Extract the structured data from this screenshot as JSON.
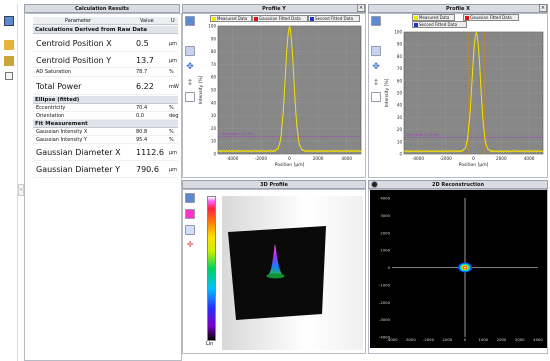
{
  "results": {
    "title": "Calculation Results",
    "col_param": "Parameter",
    "col_value": "Value",
    "col_unit": "U",
    "sections": [
      {
        "label": "Calculations Derived from Raw Data"
      },
      {
        "label": "Ellipse (fitted)"
      },
      {
        "label": "Fit Measurement"
      }
    ],
    "rows": [
      {
        "param": "Centroid Position X",
        "value": "0.5",
        "unit": "µm"
      },
      {
        "param": "Centroid Position Y",
        "value": "13.7",
        "unit": "µm"
      },
      {
        "param": "AD Saturation",
        "value": "78.7",
        "unit": "%"
      },
      {
        "param": "Total Power",
        "value": "6.22",
        "unit": "mW"
      },
      {
        "param": "Eccentricity",
        "value": "70.4",
        "unit": "%"
      },
      {
        "param": "Orientation",
        "value": "0.0",
        "unit": "deg"
      },
      {
        "param": "Gaussian Intensity X",
        "value": "80.8",
        "unit": "%"
      },
      {
        "param": "Gaussian Intensity Y",
        "value": "95.4",
        "unit": "%"
      },
      {
        "param": "Gaussian Diameter X",
        "value": "1112.6",
        "unit": "µm"
      },
      {
        "param": "Gaussian Diameter Y",
        "value": "790.6",
        "unit": "µm"
      }
    ]
  },
  "profile_y": {
    "title": "Profile Y",
    "legend": [
      "Measured Data",
      "Gaussian Fitted Data",
      "Second Fitted Data"
    ],
    "ylabel": "Intensity [%]",
    "xlabel": "Position [µm]",
    "yticks": [
      "100",
      "90",
      "80",
      "70",
      "60",
      "50",
      "40",
      "30",
      "20",
      "10",
      "0"
    ],
    "xticks": [
      "-4000",
      "-2000",
      "0",
      "2000",
      "4000"
    ],
    "clip_text": "Clip Level = 13.5%"
  },
  "profile_x": {
    "title": "Profile X",
    "legend": [
      "Measured Data",
      "Gaussian Fitted Data",
      "Second Fitted Data"
    ],
    "ylabel": "Intensity [%]",
    "xlabel": "Position [µm]",
    "yticks": [
      "100",
      "90",
      "80",
      "70",
      "60",
      "50",
      "40",
      "30",
      "20",
      "10",
      "0"
    ],
    "xticks": [
      "-4000",
      "-2000",
      "0",
      "2000",
      "4000"
    ],
    "clip_text": "Clip Level = 13.5%"
  },
  "profile3d": {
    "title": "3D Profile",
    "colorbar_label": "Lin"
  },
  "recon2d": {
    "title": "2D Reconstruction",
    "yticks": [
      "4000",
      "3000",
      "2000",
      "1000",
      "0",
      "-1000",
      "-2000",
      "-3000",
      "-4000"
    ],
    "xticks": [
      "-4000",
      "-3000",
      "-2000",
      "-1000",
      "0",
      "1000",
      "2000",
      "3000",
      "4000"
    ]
  },
  "colors": {
    "measured": "#f5e400",
    "gaussian": "#d11",
    "second": "#2233cc",
    "plot_bg": "#878787",
    "clip": "#a040c0"
  }
}
